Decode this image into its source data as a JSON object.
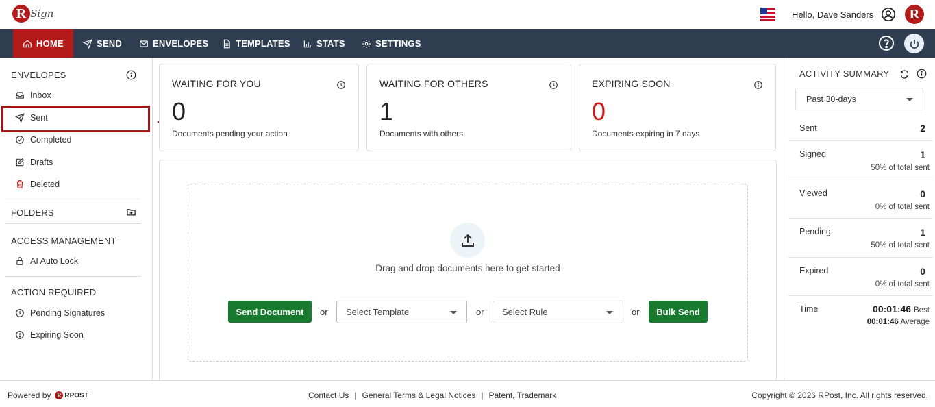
{
  "header": {
    "logo_letter": "R",
    "logo_text": "Sign",
    "greeting": "Hello, Dave Sanders",
    "avatar_letter": "R"
  },
  "nav": {
    "items": [
      {
        "label": "HOME",
        "icon": "home-icon",
        "active": true
      },
      {
        "label": "SEND",
        "icon": "send-icon"
      },
      {
        "label": "ENVELOPES",
        "icon": "envelope-icon"
      },
      {
        "label": "TEMPLATES",
        "icon": "document-icon"
      },
      {
        "label": "STATS",
        "icon": "bar-chart-icon"
      },
      {
        "label": "SETTINGS",
        "icon": "gear-icon"
      }
    ]
  },
  "sidebar": {
    "envelopes_heading": "ENVELOPES",
    "envelopes": [
      {
        "label": "Inbox",
        "icon": "inbox-icon"
      },
      {
        "label": "Sent",
        "icon": "send-icon"
      },
      {
        "label": "Completed",
        "icon": "check-circle-icon"
      },
      {
        "label": "Drafts",
        "icon": "edit-icon"
      },
      {
        "label": "Deleted",
        "icon": "trash-icon"
      }
    ],
    "folders_heading": "FOLDERS",
    "access_heading": "ACCESS MANAGEMENT",
    "access_items": [
      {
        "label": "AI Auto Lock",
        "icon": "lock-icon"
      }
    ],
    "action_heading": "ACTION REQUIRED",
    "action_items": [
      {
        "label": "Pending Signatures",
        "icon": "clock-icon"
      },
      {
        "label": "Expiring Soon",
        "icon": "alert-circle-icon"
      }
    ]
  },
  "cards": [
    {
      "title": "WAITING FOR YOU",
      "count": "0",
      "subtitle": "Documents pending your action"
    },
    {
      "title": "WAITING FOR OTHERS",
      "count": "1",
      "subtitle": "Documents with others"
    },
    {
      "title": "EXPIRING SOON",
      "count": "0",
      "subtitle": "Documents expiring in 7 days"
    }
  ],
  "dropzone": {
    "text": "Drag and drop documents here to get started",
    "send_button": "Send Document",
    "or": "or",
    "template_select": "Select Template",
    "rule_select": "Select Rule",
    "bulk_button": "Bulk Send"
  },
  "activity": {
    "heading": "ACTIVITY SUMMARY",
    "period": "Past 30-days",
    "stats": [
      {
        "label": "Sent",
        "value": "2",
        "percent": ""
      },
      {
        "label": "Signed",
        "value": "1",
        "percent": "50% of total sent"
      },
      {
        "label": "Viewed",
        "value": "0",
        "percent": "0% of total sent"
      },
      {
        "label": "Pending",
        "value": "1",
        "percent": "50% of total sent"
      },
      {
        "label": "Expired",
        "value": "0",
        "percent": "0% of total sent"
      }
    ],
    "time_label": "Time",
    "time_best": "00:01:46",
    "time_best_label": "Best",
    "time_avg": "00:01:46",
    "time_avg_label": "Average"
  },
  "footer": {
    "powered_by": "Powered by",
    "rpost_text": "RPOST",
    "links": [
      "Contact Us",
      "General Terms & Legal Notices",
      "Patent, Trademark"
    ],
    "separator": "|",
    "copyright": "Copyright © 2026 RPost, Inc. All rights reserved."
  },
  "colors": {
    "brand_red": "#b31b1b",
    "nav_bg": "#2e3e50",
    "green_button": "#177a2f",
    "expiring_red": "#c91d1d"
  }
}
